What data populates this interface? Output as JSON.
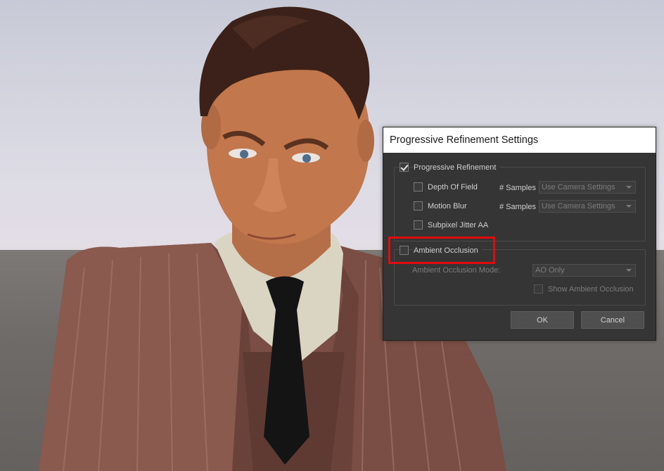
{
  "dialog": {
    "title": "Progressive Refinement Settings",
    "progressive_refinement": {
      "label": "Progressive Refinement",
      "checked": true
    },
    "depth_of_field": {
      "label": "Depth Of Field",
      "samples_label": "# Samples",
      "samples_value": "Use Camera Settings"
    },
    "motion_blur": {
      "label": "Motion Blur",
      "samples_label": "# Samples",
      "samples_value": "Use Camera Settings"
    },
    "subpixel_jitter": {
      "label": "Subpixel Jitter AA"
    },
    "ambient_occlusion": {
      "label": "Ambient Occlusion",
      "checked": false
    },
    "ao_mode": {
      "label": "Ambient Occlusion Mode:",
      "value": "AO Only"
    },
    "show_ao": {
      "label": "Show Ambient Occlusion"
    },
    "ok_label": "OK",
    "cancel_label": "Cancel"
  },
  "colors": {
    "highlight": "#e00c0c",
    "dialog_bg": "#353535"
  }
}
